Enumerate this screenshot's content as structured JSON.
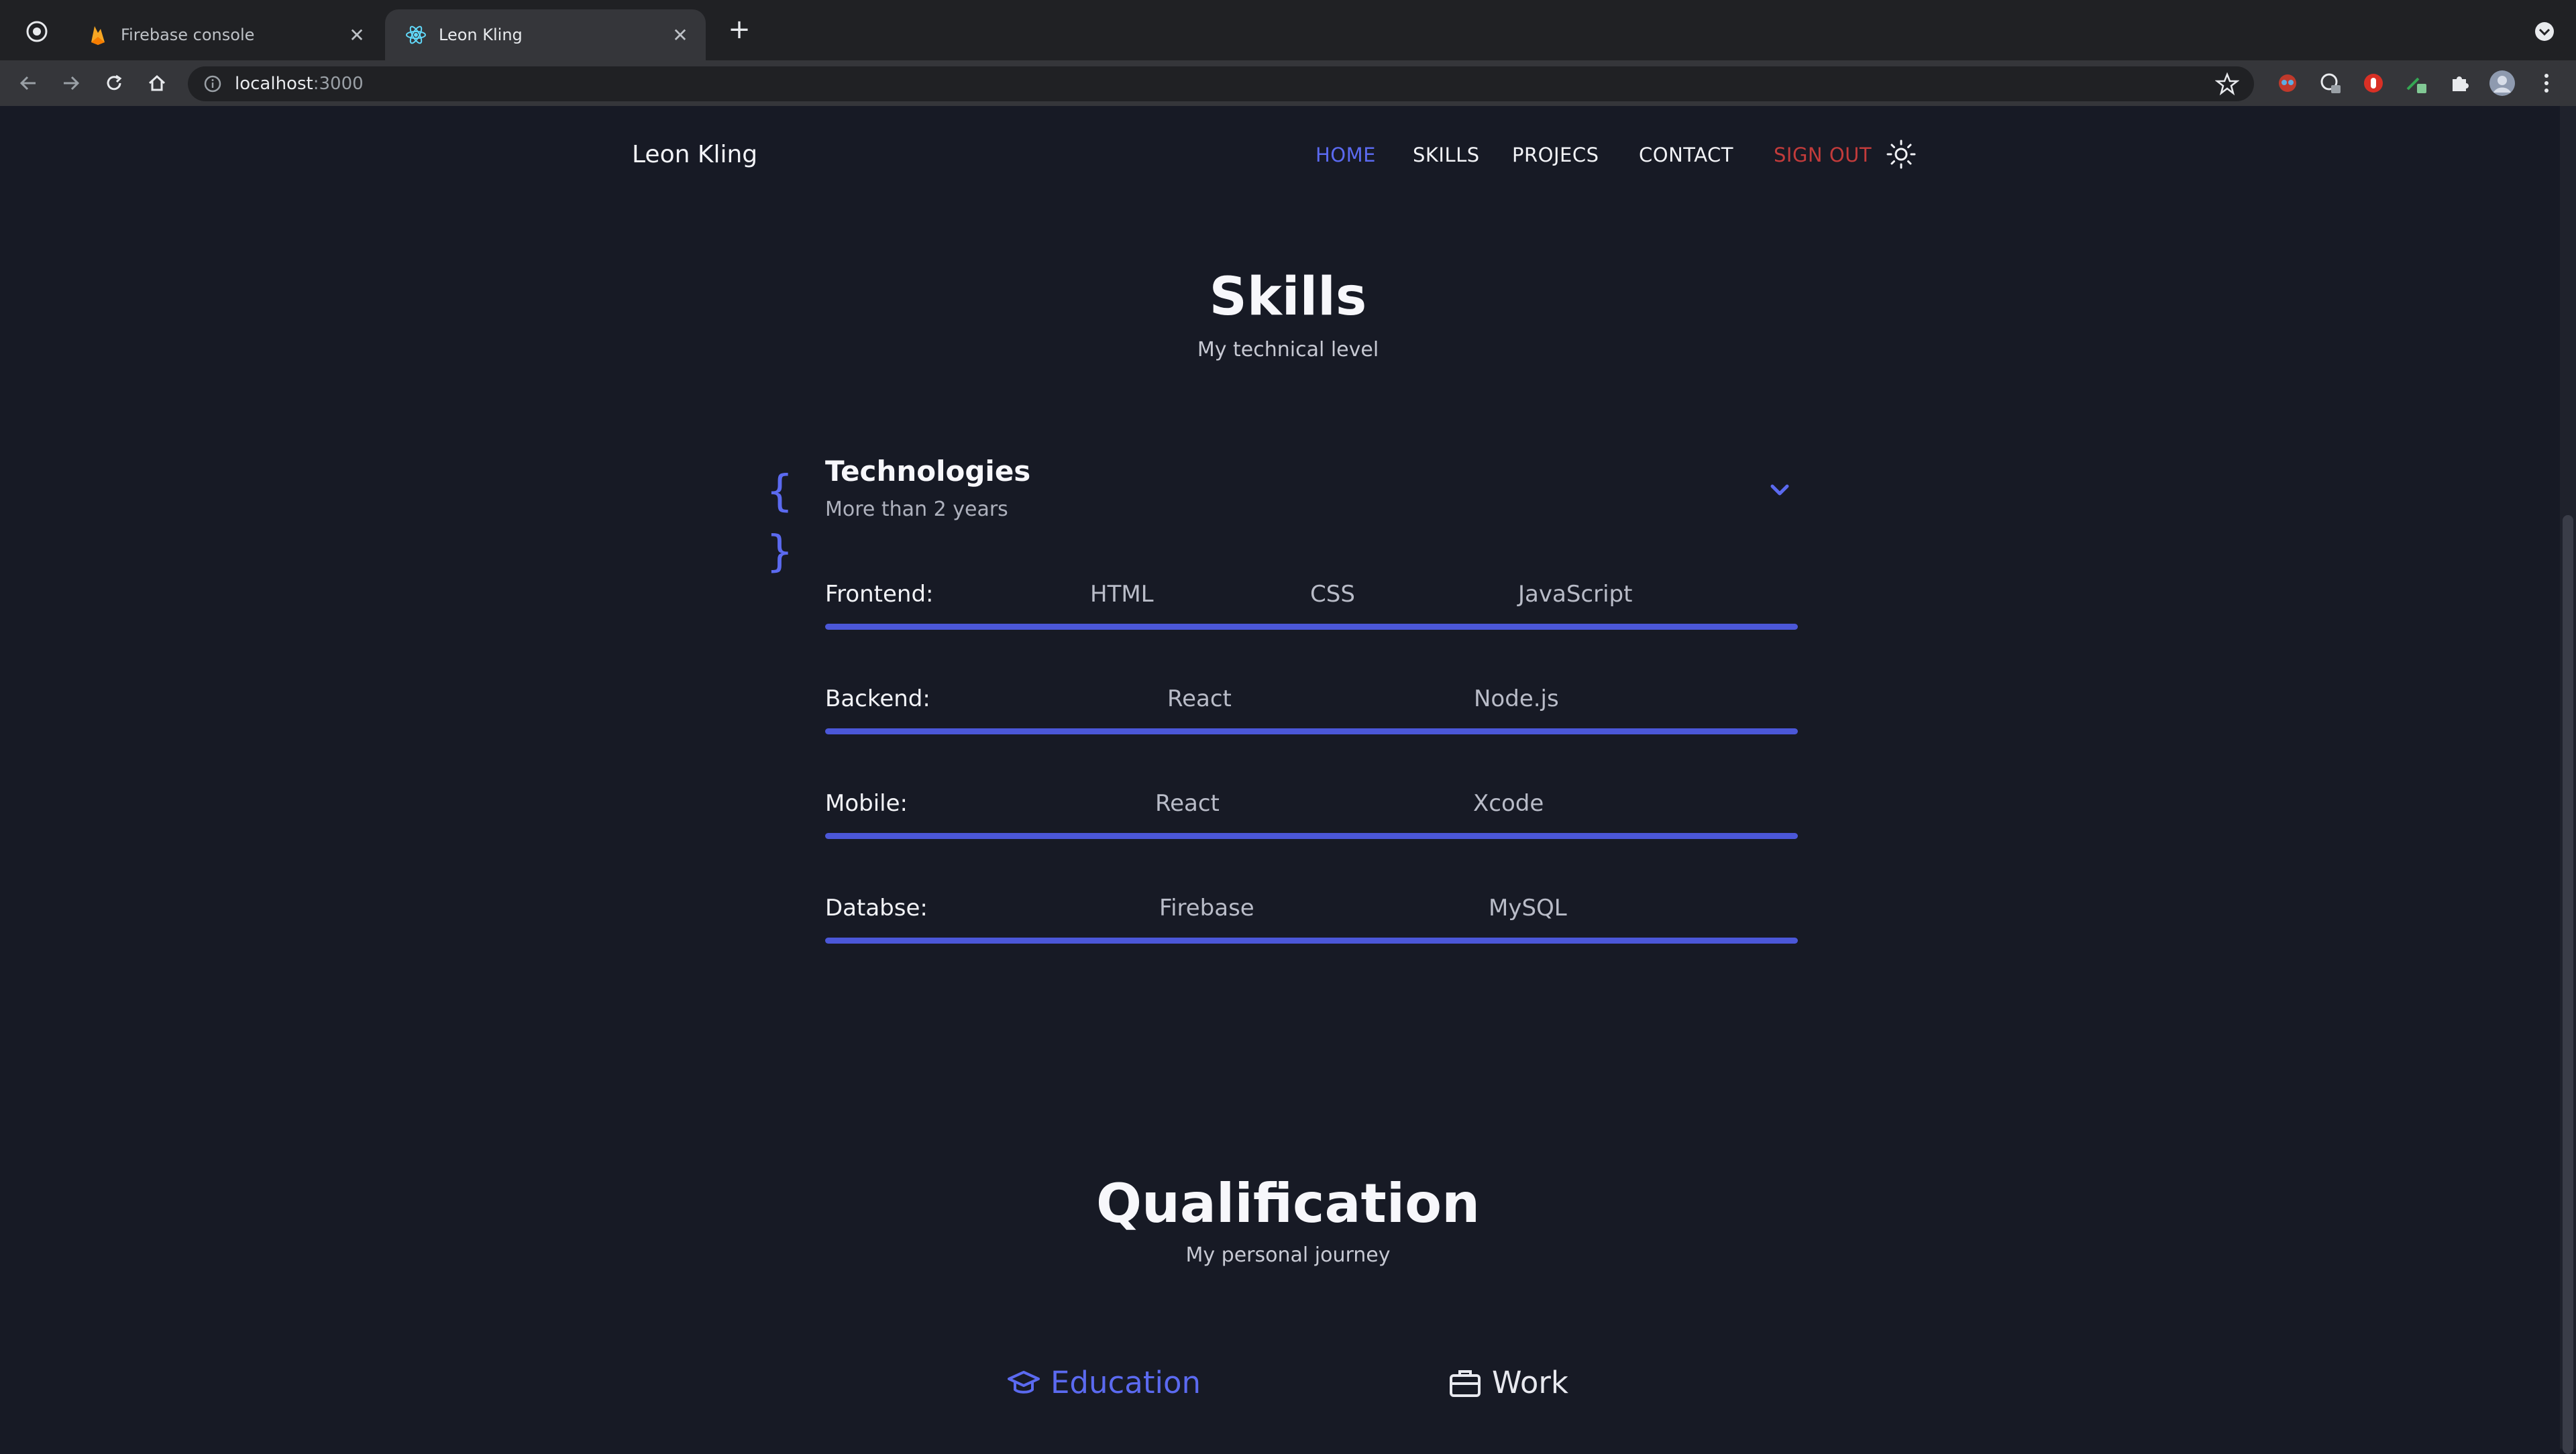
{
  "browser": {
    "tabs": [
      {
        "title": "Firebase console",
        "icon": "firebase-icon",
        "active": false
      },
      {
        "title": "Leon Kling",
        "icon": "react-icon",
        "active": true
      }
    ],
    "new_tab_symbol": "+",
    "url_host": "localhost",
    "url_port": ":3000"
  },
  "site": {
    "brand": "Leon Kling",
    "nav": {
      "home": "HOME",
      "skills": "SKILLS",
      "projects": "PROJECS",
      "contact": "CONTACT",
      "sign_out": "SIGN OUT"
    },
    "colors": {
      "accent": "#5b6af0",
      "danger": "#c23b3b",
      "background": "#171a25"
    }
  },
  "skills": {
    "title": "Skills",
    "subtitle": "My technical level",
    "group": {
      "icon": "braces-icon",
      "title": "Technologies",
      "subtitle": "More than 2 years",
      "braces": "{ }"
    },
    "rows": [
      {
        "label": "Frontend:",
        "items": [
          "HTML",
          "CSS",
          "JavaScript"
        ]
      },
      {
        "label": "Backend:",
        "items": [
          "React",
          "Node.js"
        ]
      },
      {
        "label": "Mobile:",
        "items": [
          "React",
          "Xcode"
        ]
      },
      {
        "label": "Databse:",
        "items": [
          "Firebase",
          "MySQL"
        ]
      }
    ]
  },
  "qualification": {
    "title": "Qualification",
    "subtitle": "My personal journey",
    "tabs": {
      "education": "Education",
      "work": "Work"
    }
  }
}
